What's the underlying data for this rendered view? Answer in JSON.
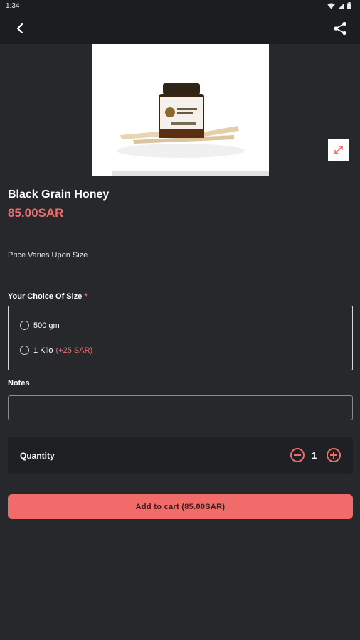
{
  "status_bar": {
    "time": "1:34"
  },
  "product": {
    "name": "Black Grain Honey",
    "price": "85.00SAR",
    "price_note": "Price Varies Upon Size"
  },
  "size_choice": {
    "label": "Your Choice Of Size",
    "required_mark": "*",
    "options": [
      {
        "label": "500 gm",
        "extra": ""
      },
      {
        "label": "1 Kilo",
        "extra": "(+25 SAR)"
      }
    ]
  },
  "notes": {
    "label": "Notes",
    "value": ""
  },
  "quantity": {
    "label": "Quantity",
    "value": "1"
  },
  "cart_button": {
    "label": "Add to cart (85.00SAR)"
  },
  "colors": {
    "background": "#27282c",
    "app_bar": "#1c1d20",
    "accent": "#f26b6b"
  },
  "icons": {
    "back": "back-arrow-icon",
    "share": "share-icon",
    "expand": "expand-icon",
    "minus": "minus-circle-icon",
    "plus": "plus-circle-icon"
  }
}
